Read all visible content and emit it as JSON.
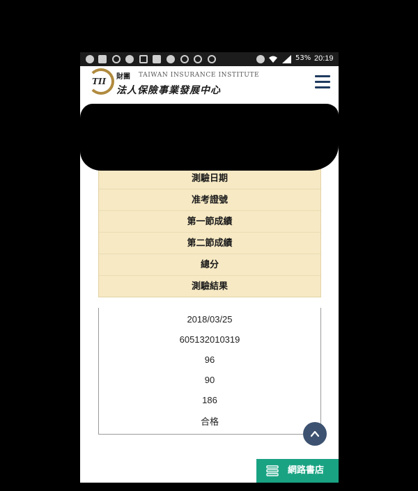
{
  "status_bar": {
    "battery": "53%",
    "time": "20:19"
  },
  "header": {
    "logo_mark": "TII",
    "logo_prefix": "財團",
    "logo_english": "TAIWAN INSURANCE INSTITUTE",
    "logo_chinese": "法人保險事業發展中心",
    "menu_icon": "hamburger-menu-icon"
  },
  "result_labels": [
    "測驗日期",
    "准考證號",
    "第一節成績",
    "第二節成績",
    "總分",
    "測驗結果"
  ],
  "result_values": [
    "2018/03/25",
    "605132010319",
    "96",
    "90",
    "186",
    "合格"
  ],
  "floating": {
    "scroll_top_icon": "chevron-up-icon",
    "bookstore_icon": "book-stack-icon",
    "bookstore_label": "網路書店"
  },
  "colors": {
    "label_bg": "#f6e9c4",
    "accent_navy": "#1f3a5f",
    "bookstore_green": "#1aa383",
    "logo_gold": "#b08a3e"
  }
}
